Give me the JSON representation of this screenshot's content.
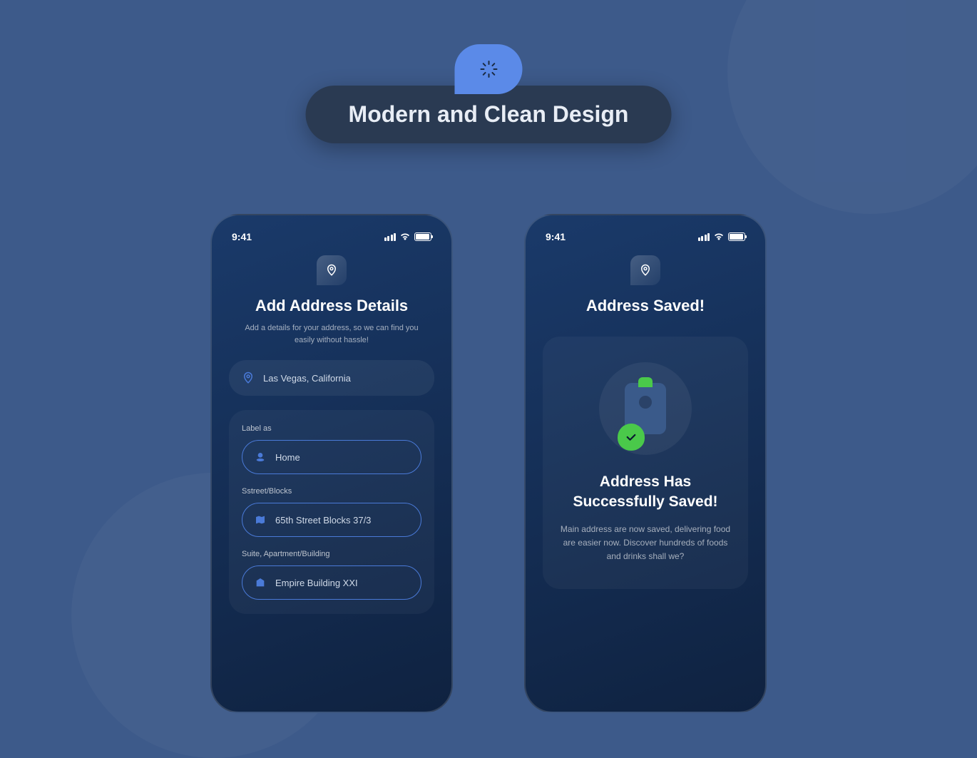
{
  "header": {
    "title": "Modern and Clean Design"
  },
  "status": {
    "time": "9:41"
  },
  "screen1": {
    "title": "Add Address Details",
    "subtitle": "Add a details for your address, so we can find you easily without hassle!",
    "location": "Las Vegas, California",
    "form": {
      "label_field": {
        "label": "Label as",
        "value": "Home"
      },
      "street_field": {
        "label": "Sstreet/Blocks",
        "value": "65th Street Blocks 37/3"
      },
      "suite_field": {
        "label": "Suite, Apartment/Building",
        "value": "Empire Building XXI"
      }
    }
  },
  "screen2": {
    "title": "Address Saved!",
    "success_title": "Address Has Successfully Saved!",
    "success_body": "Main address are now saved, delivering food are easier now. Discover hundreds of foods and drinks shall we?"
  }
}
